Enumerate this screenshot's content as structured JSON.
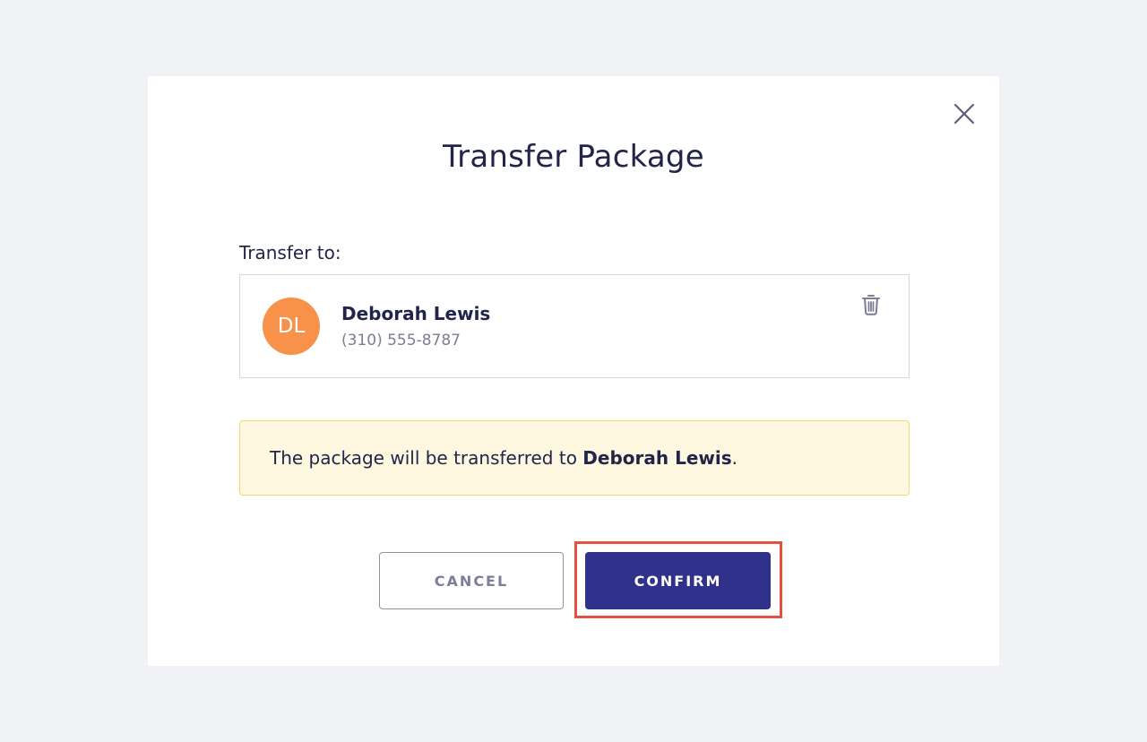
{
  "modal": {
    "title": "Transfer Package",
    "close_icon": "close-icon"
  },
  "transfer": {
    "label": "Transfer to:",
    "recipient": {
      "initials": "DL",
      "name": "Deborah Lewis",
      "phone": "(310) 555-8787",
      "avatar_color": "#f8914a",
      "delete_icon": "trash-icon"
    }
  },
  "notice": {
    "prefix": "The package will be transferred to ",
    "name": "Deborah Lewis",
    "suffix": ".",
    "background_color": "#fff8e1",
    "border_color": "#f4d76a"
  },
  "actions": {
    "cancel_label": "CANCEL",
    "confirm_label": "CONFIRM",
    "confirm_color": "#2f318a",
    "highlight_color": "#e5513f"
  }
}
